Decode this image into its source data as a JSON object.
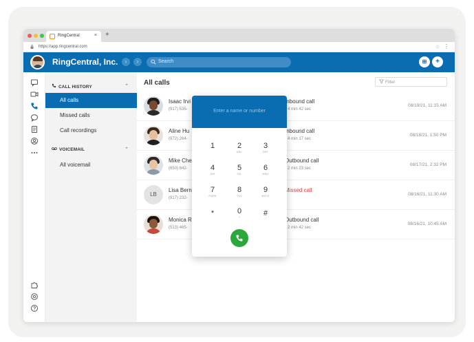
{
  "browser": {
    "tab_title": "RingCentral",
    "tab_close": "×",
    "new_tab": "+",
    "url": "https://app.ringcentral.com",
    "menu_glyph": "⋮",
    "star_glyph": "☆"
  },
  "header": {
    "app_title": "RingCentral, Inc.",
    "back_glyph": "‹",
    "forward_glyph": "›",
    "search_placeholder": "Search",
    "apps_glyph": "⊞",
    "add_glyph": "+"
  },
  "sidebar": {
    "call_history": {
      "title": "CALL HISTORY",
      "items": [
        {
          "label": "All calls",
          "active": true
        },
        {
          "label": "Missed calls",
          "active": false
        },
        {
          "label": "Call recordings",
          "active": false
        }
      ]
    },
    "voicemail": {
      "title": "VOICEMAIL",
      "items": [
        {
          "label": "All voicemail",
          "active": false
        }
      ]
    }
  },
  "main": {
    "title": "All calls",
    "filter_placeholder": "Filter",
    "calls": [
      {
        "name": "Isaac Irvi",
        "phone": "(917) 535-",
        "type": "Inbound call",
        "duration": "4 min 42 sec",
        "time": "08/19/21, 11:15 AM",
        "missed": false
      },
      {
        "name": "Aline Hu",
        "phone": "(972) 264-",
        "type": "Inbound call",
        "duration": "4 min 17 sec",
        "time": "08/18/21, 1:50 PM",
        "missed": false
      },
      {
        "name": "Mike Che",
        "phone": "(650) 842-",
        "type": "Outbound call",
        "duration": "2 min 23 sec",
        "time": "08/17/21, 2:32 PM",
        "missed": false
      },
      {
        "name": "Lisa Bern",
        "phone": "(917) 232-",
        "initials": "LB",
        "type": "Missed call",
        "duration": "",
        "time": "08/16/21, 11:30 AM",
        "missed": true
      },
      {
        "name": "Monica R",
        "phone": "(513) 465-",
        "type": "Outbound call",
        "duration": "2 min 42 sec",
        "time": "08/16/21, 10:45 AM",
        "missed": false
      }
    ]
  },
  "dialpad": {
    "placeholder": "Enter a name or number",
    "keys": [
      {
        "digit": "1",
        "sub": ""
      },
      {
        "digit": "2",
        "sub": "ABC"
      },
      {
        "digit": "3",
        "sub": "DEF"
      },
      {
        "digit": "4",
        "sub": "GHI"
      },
      {
        "digit": "5",
        "sub": "JKL"
      },
      {
        "digit": "6",
        "sub": "MNO"
      },
      {
        "digit": "7",
        "sub": "PQRS"
      },
      {
        "digit": "8",
        "sub": "TUV"
      },
      {
        "digit": "9",
        "sub": "WXYZ"
      },
      {
        "digit": "*",
        "sub": ""
      },
      {
        "digit": "0",
        "sub": "+"
      },
      {
        "digit": "#",
        "sub": ""
      }
    ]
  },
  "colors": {
    "brand_blue": "#0a6cb1",
    "call_green": "#2aa83c",
    "missed_red": "#e0403c"
  }
}
